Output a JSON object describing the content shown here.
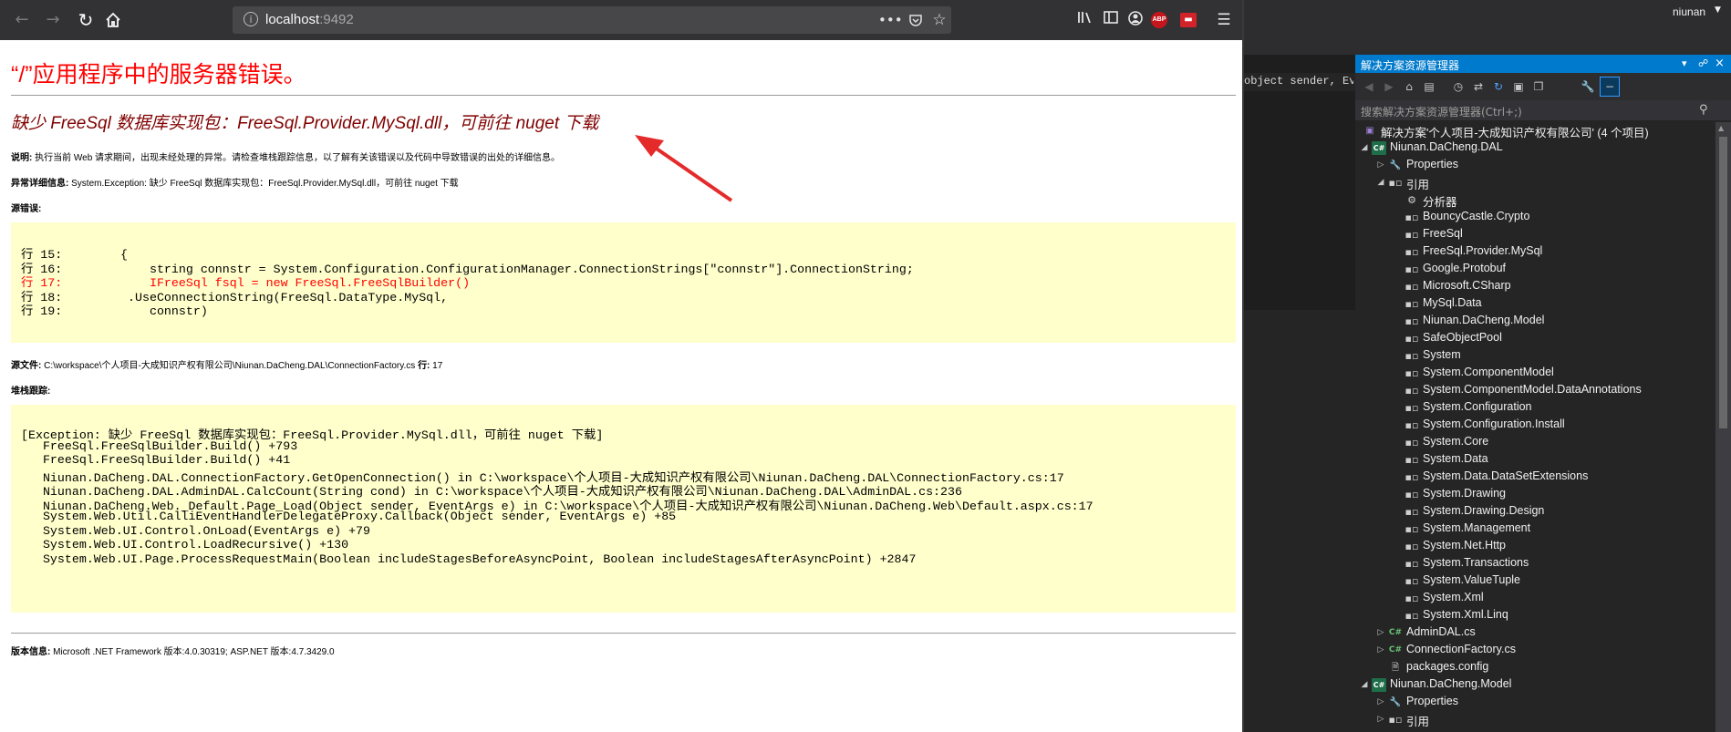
{
  "browser": {
    "url_host": "localhost",
    "url_port": ":9492",
    "icons": {
      "back": "arrow-left-icon",
      "forward": "arrow-right-icon",
      "reload": "reload-icon",
      "home": "home-icon",
      "info": "info-icon",
      "more": "ellipsis-icon",
      "pocket": "pocket-icon",
      "bookmark": "star-icon",
      "library": "library-icon",
      "sidebar": "sidebar-icon",
      "account": "account-icon",
      "abp": "ABP",
      "menu": "hamburger-icon"
    }
  },
  "error_page": {
    "title": "“/”应用程序中的服务器错误。",
    "heading": "缺少 FreeSql 数据库实现包：FreeSql.Provider.MySql.dll，可前往 nuget 下载",
    "description_label": "说明:",
    "description_text": " 执行当前 Web 请求期间，出现未经处理的异常。请检查堆栈跟踪信息，以了解有关该错误以及代码中导致错误的出处的详细信息。",
    "exception_label": "异常详细信息:",
    "exception_text": " System.Exception: 缺少 FreeSql 数据库实现包：FreeSql.Provider.MySql.dll，可前往 nuget 下载",
    "source_error_label": "源错误:",
    "source_lines": [
      {
        "text": "行 15:        {",
        "error": false
      },
      {
        "text": "行 16:            string connstr = System.Configuration.ConfigurationManager.ConnectionStrings[\"connstr\"].ConnectionString;",
        "error": false
      },
      {
        "text": "行 17:            IFreeSql fsql = new FreeSql.FreeSqlBuilder()",
        "error": true
      },
      {
        "text": "行 18:         .UseConnectionString(FreeSql.DataType.MySql,",
        "error": false
      },
      {
        "text": "行 19:            connstr)",
        "error": false
      }
    ],
    "source_file_label": "源文件:",
    "source_file_text": " C:\\workspace\\个人项目-大成知识产权有限公司\\Niunan.DaCheng.DAL\\ConnectionFactory.cs    ",
    "line_label": "行:",
    "line_text": " 17",
    "stack_label": "堆栈跟踪:",
    "stack_lines": [
      "[Exception: 缺少 FreeSql 数据库实现包：FreeSql.Provider.MySql.dll，可前往 nuget 下载]",
      "   FreeSql.FreeSqlBuilder.Build() +793",
      "   FreeSql.FreeSqlBuilder.Build() +41",
      "   Niunan.DaCheng.DAL.ConnectionFactory.GetOpenConnection() in C:\\workspace\\个人项目-大成知识产权有限公司\\Niunan.DaCheng.DAL\\ConnectionFactory.cs:17",
      "   Niunan.DaCheng.DAL.AdminDAL.CalcCount(String cond) in C:\\workspace\\个人项目-大成知识产权有限公司\\Niunan.DaCheng.DAL\\AdminDAL.cs:236",
      "   Niunan.DaCheng.Web._Default.Page_Load(Object sender, EventArgs e) in C:\\workspace\\个人项目-大成知识产权有限公司\\Niunan.DaCheng.Web\\Default.aspx.cs:17",
      "   System.Web.Util.CalliEventHandlerDelegateProxy.Callback(Object sender, EventArgs e) +85",
      "   System.Web.UI.Control.OnLoad(EventArgs e) +79",
      "   System.Web.UI.Control.LoadRecursive() +130",
      "   System.Web.UI.Page.ProcessRequestMain(Boolean includeStagesBeforeAsyncPoint, Boolean includeStagesAfterAsyncPoint) +2847"
    ],
    "version_label": "版本信息:",
    "version_text": " Microsoft .NET Framework 版本:4.0.30319; ASP.NET 版本:4.7.3429.0"
  },
  "vs": {
    "user": "niunan",
    "editor_snippet": "object sender, EventA",
    "solution_explorer": {
      "title": "解决方案资源管理器",
      "search_placeholder": "搜索解决方案资源管理器(Ctrl+;)",
      "accent": "#007acc",
      "items": [
        {
          "label": "解决方案'个人项目-大成知识产权有限公司' (4 个项目)",
          "icon": "solution-icon",
          "depth": 0,
          "exp": ""
        },
        {
          "label": "Niunan.DaCheng.DAL",
          "icon": "csharp-project-icon",
          "depth": 0,
          "exp": "open"
        },
        {
          "label": "Properties",
          "icon": "wrench-icon",
          "depth": 1,
          "exp": "closed"
        },
        {
          "label": "引用",
          "icon": "references-icon",
          "depth": 1,
          "exp": "open"
        },
        {
          "label": "分析器",
          "icon": "analyzer-icon",
          "depth": 2,
          "exp": ""
        },
        {
          "label": "BouncyCastle.Crypto",
          "icon": "reference-icon",
          "depth": 2,
          "exp": ""
        },
        {
          "label": "FreeSql",
          "icon": "reference-icon",
          "depth": 2,
          "exp": ""
        },
        {
          "label": "FreeSql.Provider.MySql",
          "icon": "reference-icon",
          "depth": 2,
          "exp": ""
        },
        {
          "label": "Google.Protobuf",
          "icon": "reference-icon",
          "depth": 2,
          "exp": ""
        },
        {
          "label": "Microsoft.CSharp",
          "icon": "reference-icon",
          "depth": 2,
          "exp": ""
        },
        {
          "label": "MySql.Data",
          "icon": "reference-icon",
          "depth": 2,
          "exp": ""
        },
        {
          "label": "Niunan.DaCheng.Model",
          "icon": "reference-icon",
          "depth": 2,
          "exp": ""
        },
        {
          "label": "SafeObjectPool",
          "icon": "reference-icon",
          "depth": 2,
          "exp": ""
        },
        {
          "label": "System",
          "icon": "reference-icon",
          "depth": 2,
          "exp": ""
        },
        {
          "label": "System.ComponentModel",
          "icon": "reference-icon",
          "depth": 2,
          "exp": ""
        },
        {
          "label": "System.ComponentModel.DataAnnotations",
          "icon": "reference-icon",
          "depth": 2,
          "exp": ""
        },
        {
          "label": "System.Configuration",
          "icon": "reference-icon",
          "depth": 2,
          "exp": ""
        },
        {
          "label": "System.Configuration.Install",
          "icon": "reference-icon",
          "depth": 2,
          "exp": ""
        },
        {
          "label": "System.Core",
          "icon": "reference-icon",
          "depth": 2,
          "exp": ""
        },
        {
          "label": "System.Data",
          "icon": "reference-icon",
          "depth": 2,
          "exp": ""
        },
        {
          "label": "System.Data.DataSetExtensions",
          "icon": "reference-icon",
          "depth": 2,
          "exp": ""
        },
        {
          "label": "System.Drawing",
          "icon": "reference-icon",
          "depth": 2,
          "exp": ""
        },
        {
          "label": "System.Drawing.Design",
          "icon": "reference-icon",
          "depth": 2,
          "exp": ""
        },
        {
          "label": "System.Management",
          "icon": "reference-icon",
          "depth": 2,
          "exp": ""
        },
        {
          "label": "System.Net.Http",
          "icon": "reference-icon",
          "depth": 2,
          "exp": ""
        },
        {
          "label": "System.Transactions",
          "icon": "reference-icon",
          "depth": 2,
          "exp": ""
        },
        {
          "label": "System.ValueTuple",
          "icon": "reference-icon",
          "depth": 2,
          "exp": ""
        },
        {
          "label": "System.Xml",
          "icon": "reference-icon",
          "depth": 2,
          "exp": ""
        },
        {
          "label": "System.Xml.Linq",
          "icon": "reference-icon",
          "depth": 2,
          "exp": ""
        },
        {
          "label": "AdminDAL.cs",
          "icon": "csharp-file-icon",
          "depth": 1,
          "exp": "closed"
        },
        {
          "label": "ConnectionFactory.cs",
          "icon": "csharp-file-icon",
          "depth": 1,
          "exp": "closed"
        },
        {
          "label": "packages.config",
          "icon": "config-file-icon",
          "depth": 1,
          "exp": ""
        },
        {
          "label": "Niunan.DaCheng.Model",
          "icon": "csharp-project-icon",
          "depth": 0,
          "exp": "open"
        },
        {
          "label": "Properties",
          "icon": "wrench-icon",
          "depth": 1,
          "exp": "closed"
        },
        {
          "label": "引用",
          "icon": "references-icon",
          "depth": 1,
          "exp": "closed"
        }
      ]
    }
  }
}
